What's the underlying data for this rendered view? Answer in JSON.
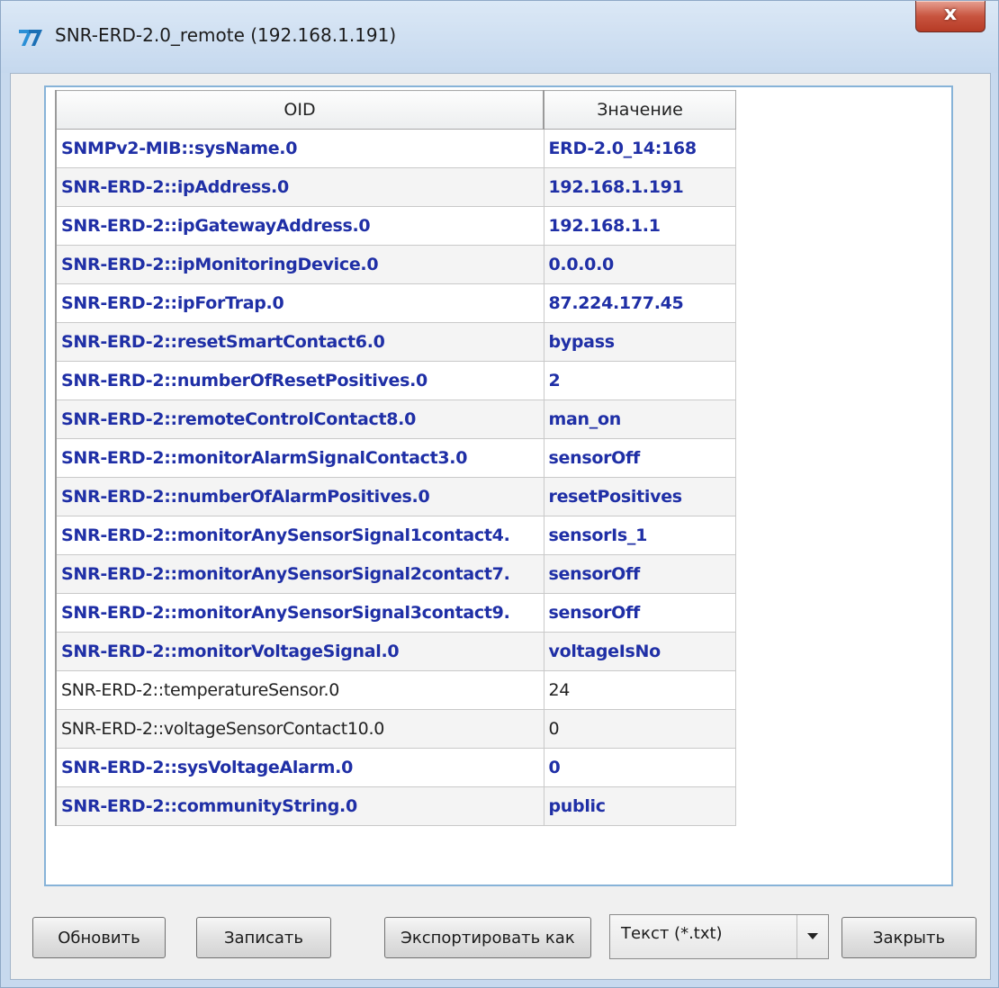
{
  "window": {
    "title": "SNR-ERD-2.0_remote (192.168.1.191)",
    "close_label": "x"
  },
  "table": {
    "headers": {
      "oid": "OID",
      "value": "Значение"
    },
    "rows": [
      {
        "oid": "SNMPv2-MIB::sysName.0",
        "value": "ERD-2.0_14:168",
        "bold": true
      },
      {
        "oid": "SNR-ERD-2::ipAddress.0",
        "value": "192.168.1.191",
        "bold": true
      },
      {
        "oid": "SNR-ERD-2::ipGatewayAddress.0",
        "value": "192.168.1.1",
        "bold": true
      },
      {
        "oid": "SNR-ERD-2::ipMonitoringDevice.0",
        "value": "0.0.0.0",
        "bold": true
      },
      {
        "oid": "SNR-ERD-2::ipForTrap.0",
        "value": "87.224.177.45",
        "bold": true
      },
      {
        "oid": "SNR-ERD-2::resetSmartContact6.0",
        "value": "bypass",
        "bold": true
      },
      {
        "oid": "SNR-ERD-2::numberOfResetPositives.0",
        "value": "2",
        "bold": true
      },
      {
        "oid": "SNR-ERD-2::remoteControlContact8.0",
        "value": "man_on",
        "bold": true
      },
      {
        "oid": "SNR-ERD-2::monitorAlarmSignalContact3.0",
        "value": "sensorOff",
        "bold": true
      },
      {
        "oid": "SNR-ERD-2::numberOfAlarmPositives.0",
        "value": "resetPositives",
        "bold": true
      },
      {
        "oid": "SNR-ERD-2::monitorAnySensorSignal1contact4.",
        "value": "sensorIs_1",
        "bold": true
      },
      {
        "oid": "SNR-ERD-2::monitorAnySensorSignal2contact7.",
        "value": "sensorOff",
        "bold": true
      },
      {
        "oid": "SNR-ERD-2::monitorAnySensorSignal3contact9.",
        "value": "sensorOff",
        "bold": true
      },
      {
        "oid": "SNR-ERD-2::monitorVoltageSignal.0",
        "value": "voltageIsNo",
        "bold": true
      },
      {
        "oid": "SNR-ERD-2::temperatureSensor.0",
        "value": "24",
        "bold": false
      },
      {
        "oid": "SNR-ERD-2::voltageSensorContact10.0",
        "value": "0",
        "bold": false
      },
      {
        "oid": "SNR-ERD-2::sysVoltageAlarm.0",
        "value": "0",
        "bold": true
      },
      {
        "oid": "SNR-ERD-2::communityString.0",
        "value": "public",
        "bold": true
      }
    ]
  },
  "buttons": {
    "refresh": "Обновить",
    "write": "Записать",
    "export": "Экспортировать как",
    "close": "Закрыть"
  },
  "format_select": {
    "selected": "Текст (*.txt)"
  }
}
